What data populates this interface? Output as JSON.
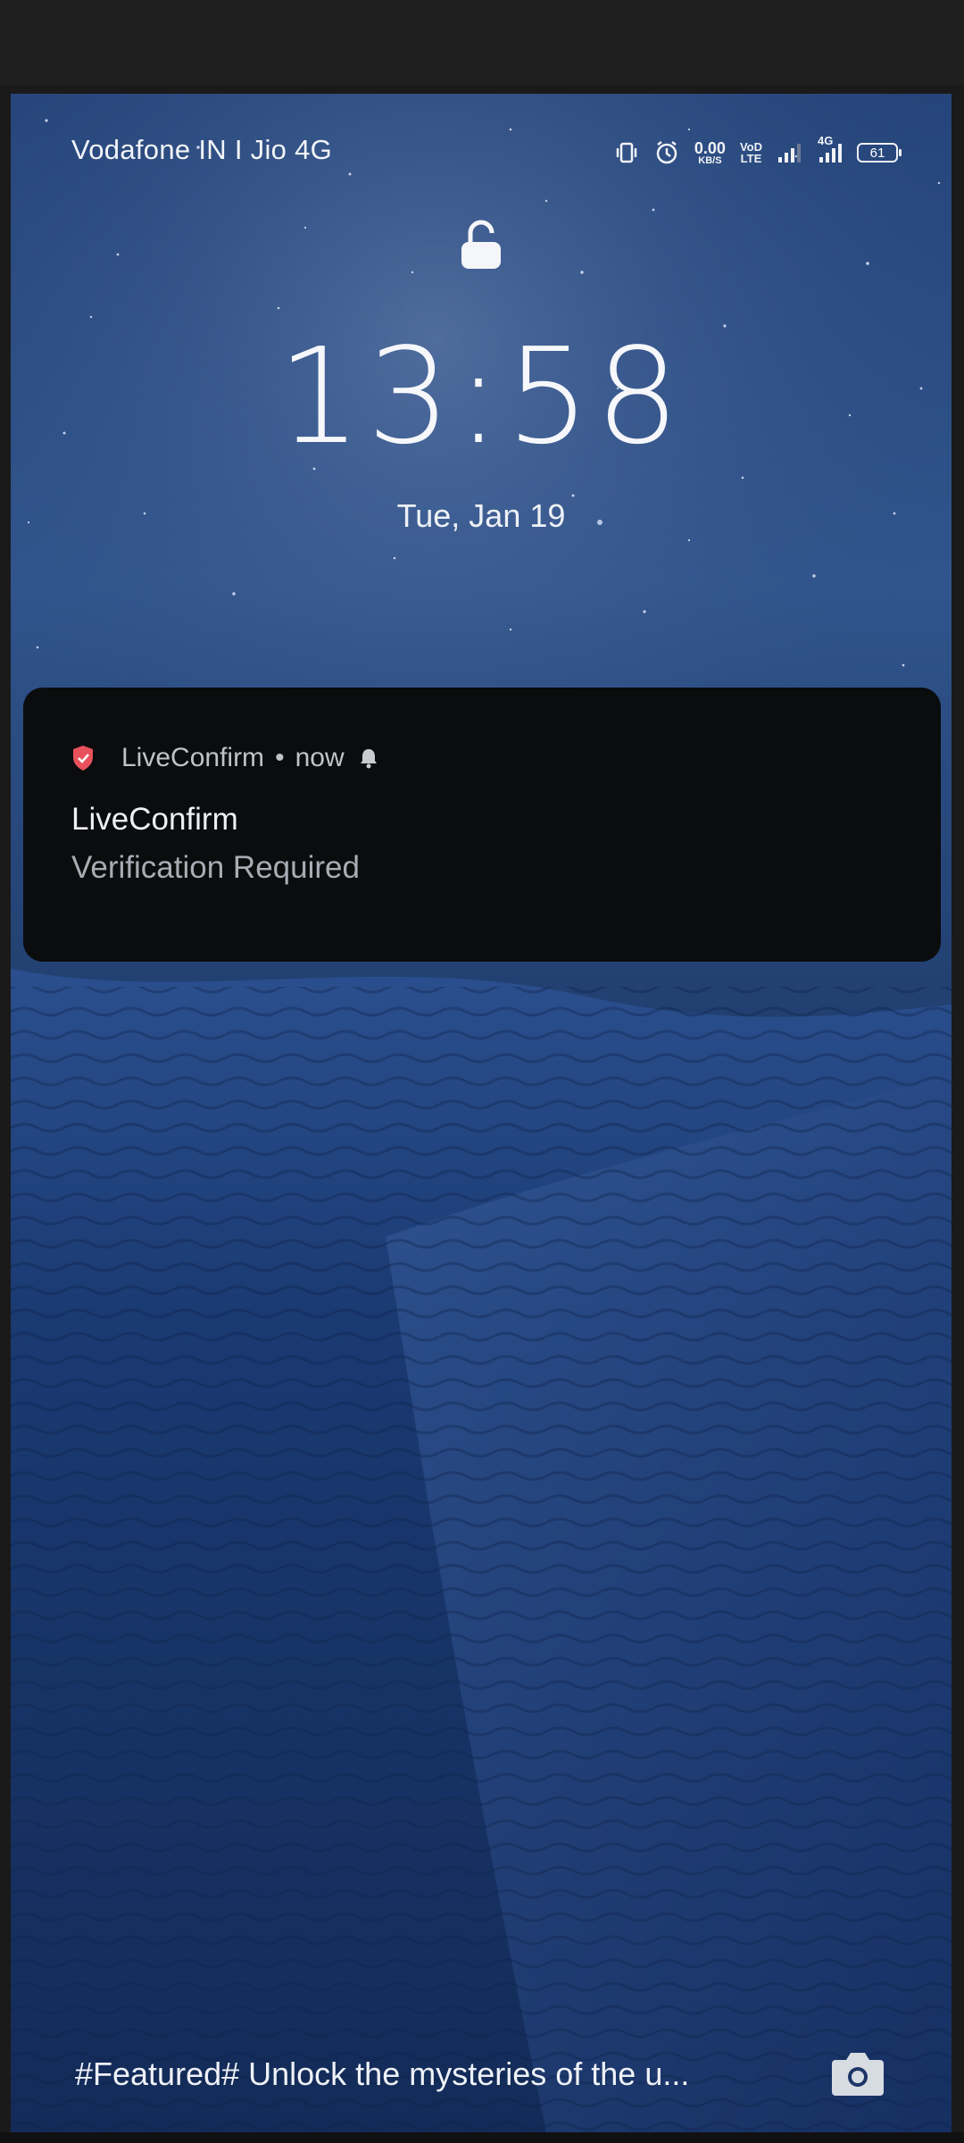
{
  "status_bar": {
    "carrier": "Vodafone IN I Jio 4G",
    "net_speed_value": "0.00",
    "net_speed_unit": "KB/S",
    "volte_top": "VoD",
    "volte_bottom": "LTE",
    "network_type": "4G",
    "battery_level": "61",
    "icons": [
      "vibrate-icon",
      "alarm-icon",
      "signal-icon",
      "battery-icon"
    ]
  },
  "lockscreen": {
    "time": "13:58",
    "date": "Tue, Jan 19",
    "lock_icon": "unlocked-padlock-icon"
  },
  "notification": {
    "app_name": "LiveConfirm",
    "separator": "•",
    "time": "now",
    "title": "LiveConfirm",
    "body": "Verification Required",
    "app_icon": "shield-icon",
    "app_icon_color": "#e8505b"
  },
  "footer": {
    "featured_text": "#Featured# Unlock the mysteries of the u...",
    "camera_icon": "camera-icon"
  },
  "colors": {
    "sky_top": "#1d3a6e",
    "sand": "#14305f",
    "notification_bg": "#0a0c0e"
  }
}
